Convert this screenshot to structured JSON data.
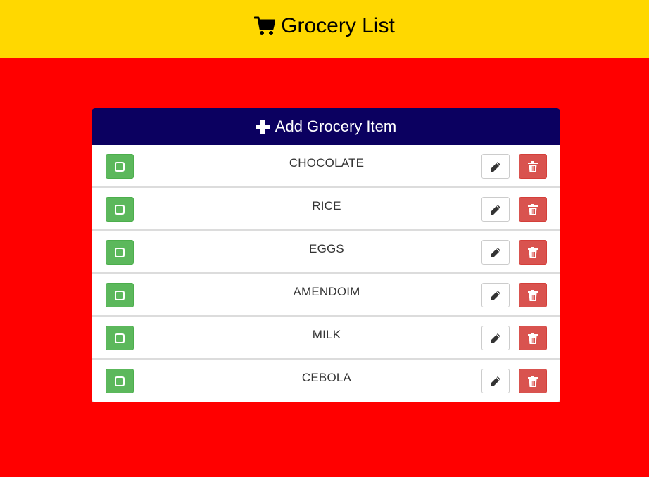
{
  "header": {
    "title": "Grocery List",
    "icon": "shopping-cart-icon",
    "background": "#ffd800"
  },
  "page": {
    "background": "#ff0000"
  },
  "add_button": {
    "label": "Add Grocery Item",
    "icon": "plus-icon",
    "background": "#0b0060"
  },
  "items": [
    {
      "name": "CHOCOLATE"
    },
    {
      "name": "RICE"
    },
    {
      "name": "EGGS"
    },
    {
      "name": "AMENDOIM"
    },
    {
      "name": "MILK"
    },
    {
      "name": "CEBOLA"
    }
  ],
  "item_actions": {
    "check_icon": "checkbox-square-icon",
    "check_color": "#5cb85c",
    "edit_icon": "pencil-icon",
    "delete_icon": "trash-icon",
    "delete_color": "#d9534f"
  }
}
